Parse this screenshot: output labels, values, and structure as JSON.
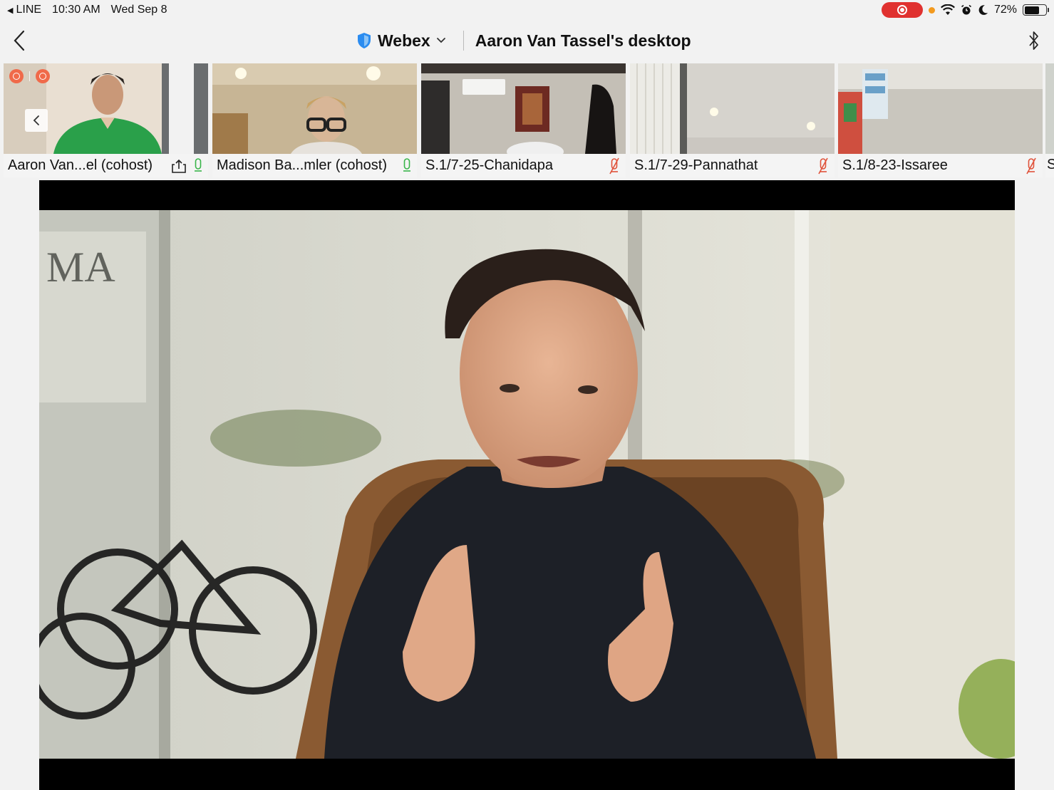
{
  "status_bar": {
    "back_app": "LINE",
    "time": "10:30 AM",
    "date": "Wed Sep 8",
    "battery_percent": "72%",
    "battery_level": 0.72,
    "icons": [
      "screen-record-icon",
      "orange-mic-dot",
      "wifi-icon",
      "alarm-icon",
      "moon-icon",
      "battery-icon"
    ]
  },
  "navbar": {
    "app_title": "Webex",
    "shared_title": "Aaron Van Tassel's desktop",
    "icons": [
      "back-chevron-icon",
      "shield-icon",
      "chevron-down-icon",
      "bluetooth-icon"
    ]
  },
  "filmstrip": {
    "participants": [
      {
        "name": "Aaron Van...el (cohost)",
        "mic": "on",
        "sharing": true
      },
      {
        "name": "Madison Ba...mler (cohost)",
        "mic": "on",
        "sharing": false
      },
      {
        "name": "S.1/7-25-Chanidapa",
        "mic": "muted",
        "sharing": false
      },
      {
        "name": "S.1/7-29-Pannathat",
        "mic": "muted",
        "sharing": false
      },
      {
        "name": "S.1/8-23-Issaree",
        "mic": "muted",
        "sharing": false
      }
    ],
    "partial_next_label": "S"
  },
  "colors": {
    "accent_blue": "#2b8cf0",
    "mic_on_green": "#39b54a",
    "mic_muted_red": "#e0523a",
    "record_red": "#e0312f"
  }
}
